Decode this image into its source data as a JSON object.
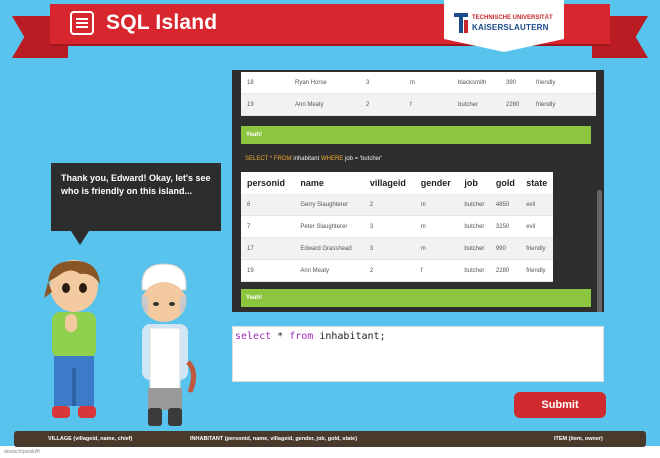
{
  "header": {
    "title": "SQL Island",
    "university_line1": "TECHNISCHE UNIVERSITÄT",
    "university_line2": "KAISERSLAUTERN"
  },
  "colors": {
    "background": "#58c3ec",
    "ribbon": "#d8262e",
    "panel": "#2e2e2e",
    "success": "#8cc63f",
    "submit": "#cf2a2e",
    "schema_bar": "#4a3a2c"
  },
  "result_prev": {
    "rows": [
      [
        "18",
        "Ryan Horse",
        "3",
        "m",
        "blacksmith",
        "390",
        "friendly"
      ],
      [
        "19",
        "Ann Meaty",
        "2",
        "f",
        "butcher",
        "2280",
        "friendly"
      ]
    ],
    "status": "Yeah!"
  },
  "query": {
    "kw_select": "SELECT",
    "star": "*",
    "kw_from": "FROM",
    "table": "inhabitant",
    "kw_where": "WHERE",
    "condition": "job = 'butcher'"
  },
  "result": {
    "columns": [
      "personid",
      "name",
      "villageid",
      "gender",
      "job",
      "gold",
      "state"
    ],
    "rows": [
      [
        "6",
        "Gerry Slaughterer",
        "2",
        "m",
        "butcher",
        "4850",
        "evil"
      ],
      [
        "7",
        "Peter Slaughterer",
        "3",
        "m",
        "butcher",
        "3250",
        "evil"
      ],
      [
        "17",
        "Edward Grasshead",
        "3",
        "m",
        "butcher",
        "990",
        "friendly"
      ],
      [
        "19",
        "Ann Meaty",
        "2",
        "f",
        "butcher",
        "2280",
        "friendly"
      ]
    ],
    "status": "Yeah!"
  },
  "bubble": {
    "text": "Thank you, Edward! Okay, let's see who is friendly on this island..."
  },
  "editor": {
    "kw1": "select",
    "op": "*",
    "kw2": "from",
    "rest": "inhabitant;"
  },
  "submit_label": "Submit",
  "schema": {
    "village": "VILLAGE (villageid, name, chief)",
    "inhabitant": "INHABITANT (personid, name, villageid, gender, job, gold, state)",
    "item": "ITEM (item, owner)"
  },
  "footer": "deutsch/polski/fr"
}
